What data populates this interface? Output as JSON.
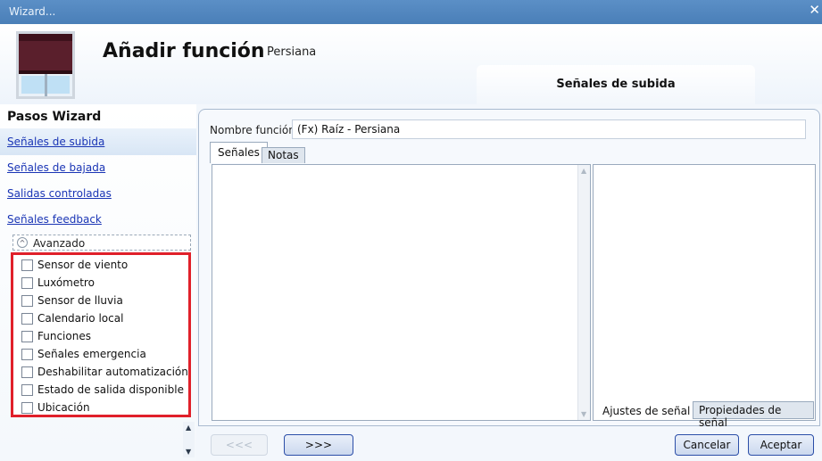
{
  "window": {
    "title": "Wizard...",
    "close_glyph": "✕"
  },
  "header": {
    "title": "Añadir función",
    "subtitle": "Persiana",
    "current_step": "Señales de subida",
    "icon": "window-blind-icon"
  },
  "sidebar": {
    "heading": "Pasos Wizard",
    "steps": [
      {
        "label": "Señales de subida"
      },
      {
        "label": "Señales de bajada"
      },
      {
        "label": "Salidas controladas"
      },
      {
        "label": "Señales feedback"
      }
    ],
    "advanced": {
      "label": "Avanzado",
      "glyph": "^"
    },
    "options": [
      {
        "label": "Sensor de viento"
      },
      {
        "label": "Luxómetro"
      },
      {
        "label": "Sensor de lluvia"
      },
      {
        "label": "Calendario local"
      },
      {
        "label": "Funciones"
      },
      {
        "label": "Señales emergencia"
      },
      {
        "label": "Deshabilitar automatización"
      },
      {
        "label": "Estado de salida disponible"
      },
      {
        "label": "Ubicación"
      }
    ],
    "scroll_up": "▲",
    "scroll_down": "▼"
  },
  "main": {
    "name_label": "Nombre función:",
    "name_value": "(Fx) Raíz - Persiana",
    "tabs": [
      {
        "label": "Señales"
      },
      {
        "label": "Notas"
      }
    ],
    "right_tabs": [
      {
        "label": "Ajustes de señal"
      },
      {
        "label": "Propiedades de señal"
      }
    ],
    "scroll_up": "▲",
    "scroll_down": "▼"
  },
  "buttons": {
    "prev": "<<<",
    "next": ">>>",
    "cancel": "Cancelar",
    "accept": "Aceptar"
  },
  "colors": {
    "titlebar": "#4a7fb8",
    "link": "#1a35b5",
    "highlight_border": "#e0202a"
  }
}
